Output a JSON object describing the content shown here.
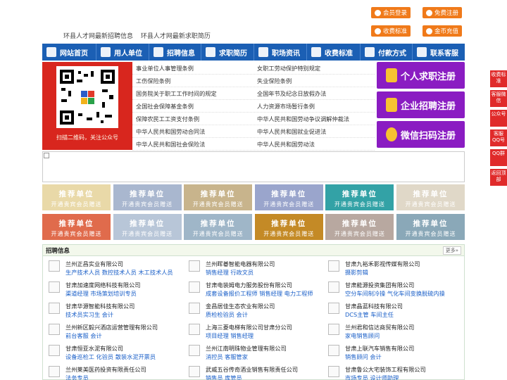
{
  "header": {
    "links": [
      "环县人才网最新招聘信息",
      "环县人才网最新求职简历"
    ],
    "top_buttons": [
      "会员登录",
      "免费注册",
      "收费标准",
      "金币充值"
    ]
  },
  "nav": {
    "items": [
      "网站首页",
      "用人单位",
      "招聘信息",
      "求职简历",
      "职场资讯",
      "收费标准",
      "付款方式",
      "联系客服"
    ]
  },
  "qr": {
    "caption": "扫描二维码，关注公众号"
  },
  "regulations": [
    [
      "事业单位人事管理条例",
      "女职工劳动保护特别规定"
    ],
    [
      "工伤保险条例",
      "失业保险条例"
    ],
    [
      "国务院关于职工工作时间的规定",
      "全国年节及纪念日放假办法"
    ],
    [
      "全国社会保障基金条例",
      "人力资源市场暂行条例"
    ],
    [
      "保障农民工工资支付条例",
      "中华人民共和国劳动争议调解仲裁法"
    ],
    [
      "中华人民共和国劳动合同法",
      "中华人民共和国就业促进法"
    ],
    [
      "中华人民共和国社会保险法",
      "中华人民共和国劳动法"
    ]
  ],
  "big_buttons": [
    "个人求职注册",
    "企业招聘注册",
    "微信扫码注册"
  ],
  "ads": {
    "title": "推荐单位",
    "subtitle": "开通贵宾会员赠送",
    "colors": [
      "#e9d9a8",
      "#a9b7cf",
      "#c8b48c",
      "#9aa5cc",
      "#33a2a6",
      "#e0d8c8",
      "#e06b4c",
      "#b8c6d8",
      "#9fb6c8",
      "#c48a26",
      "#b8a8a0",
      "#8aa8b8"
    ]
  },
  "jobs": {
    "title": "招聘信息",
    "more": "更多»",
    "columns": [
      [
        {
          "company": "兰州正昌实业有限公司",
          "positions": "生产技术人员 数控技术人员 木工技术人员"
        },
        {
          "company": "甘肃加速度网络科技有限公司",
          "positions": "渠道经理 市场策划培训专员"
        },
        {
          "company": "甘肃华源智能科技有限公司",
          "positions": "技术员实习生 会计"
        },
        {
          "company": "兰州新区毅兴酒店运营管理有限公司",
          "positions": "前台客服 会计"
        },
        {
          "company": "甘肃恒亚水泥有限公司",
          "positions": "设备巡检工 化验员 散装水泥开票员"
        },
        {
          "company": "兰州莱美医药投资有限责任公司",
          "positions": "法务专员"
        }
      ],
      [
        {
          "company": "兰州晖碁智能电器有限公司",
          "positions": "销售经理 行政文员"
        },
        {
          "company": "甘肃电装姆电力服务股份有限公司",
          "positions": "成套设备报价工程师 销售经理 电力工程师"
        },
        {
          "company": "金昌居佳生态农业有限公司",
          "positions": "质检检验员 会计"
        },
        {
          "company": "上海三菱电梯有限公司甘肃分公司",
          "positions": "项目经理 销售经理"
        },
        {
          "company": "兰州江南明珠物业管理有限公司",
          "positions": "消控员 客服管家"
        },
        {
          "company": "武威五谷传奇酒业销售有限责任公司",
          "positions": "销售员 库管员"
        }
      ],
      [
        {
          "company": "甘肃九裕禾影视传媒有限公司",
          "positions": "摄影剪辑"
        },
        {
          "company": "甘肃能源投资集团有限公司",
          "positions": "空分车间制冷操 气化车间变换脱硫内操"
        },
        {
          "company": "甘肃晶蓝科技有限公司",
          "positions": "DCS主管 车间主任"
        },
        {
          "company": "兰州君和信达商贸有限公司",
          "positions": "家电销售顾问"
        },
        {
          "company": "甘肃上联汽车销售有限公司",
          "positions": "销售顾问 会计"
        },
        {
          "company": "甘肃鲁公大宅装饰工程有限公司",
          "positions": "市场专员 设计师助理"
        }
      ]
    ]
  },
  "side_tabs": [
    "收费标准",
    "客服微信",
    "公众号",
    "客服QQ号",
    "QQ群",
    "返回顶部"
  ]
}
